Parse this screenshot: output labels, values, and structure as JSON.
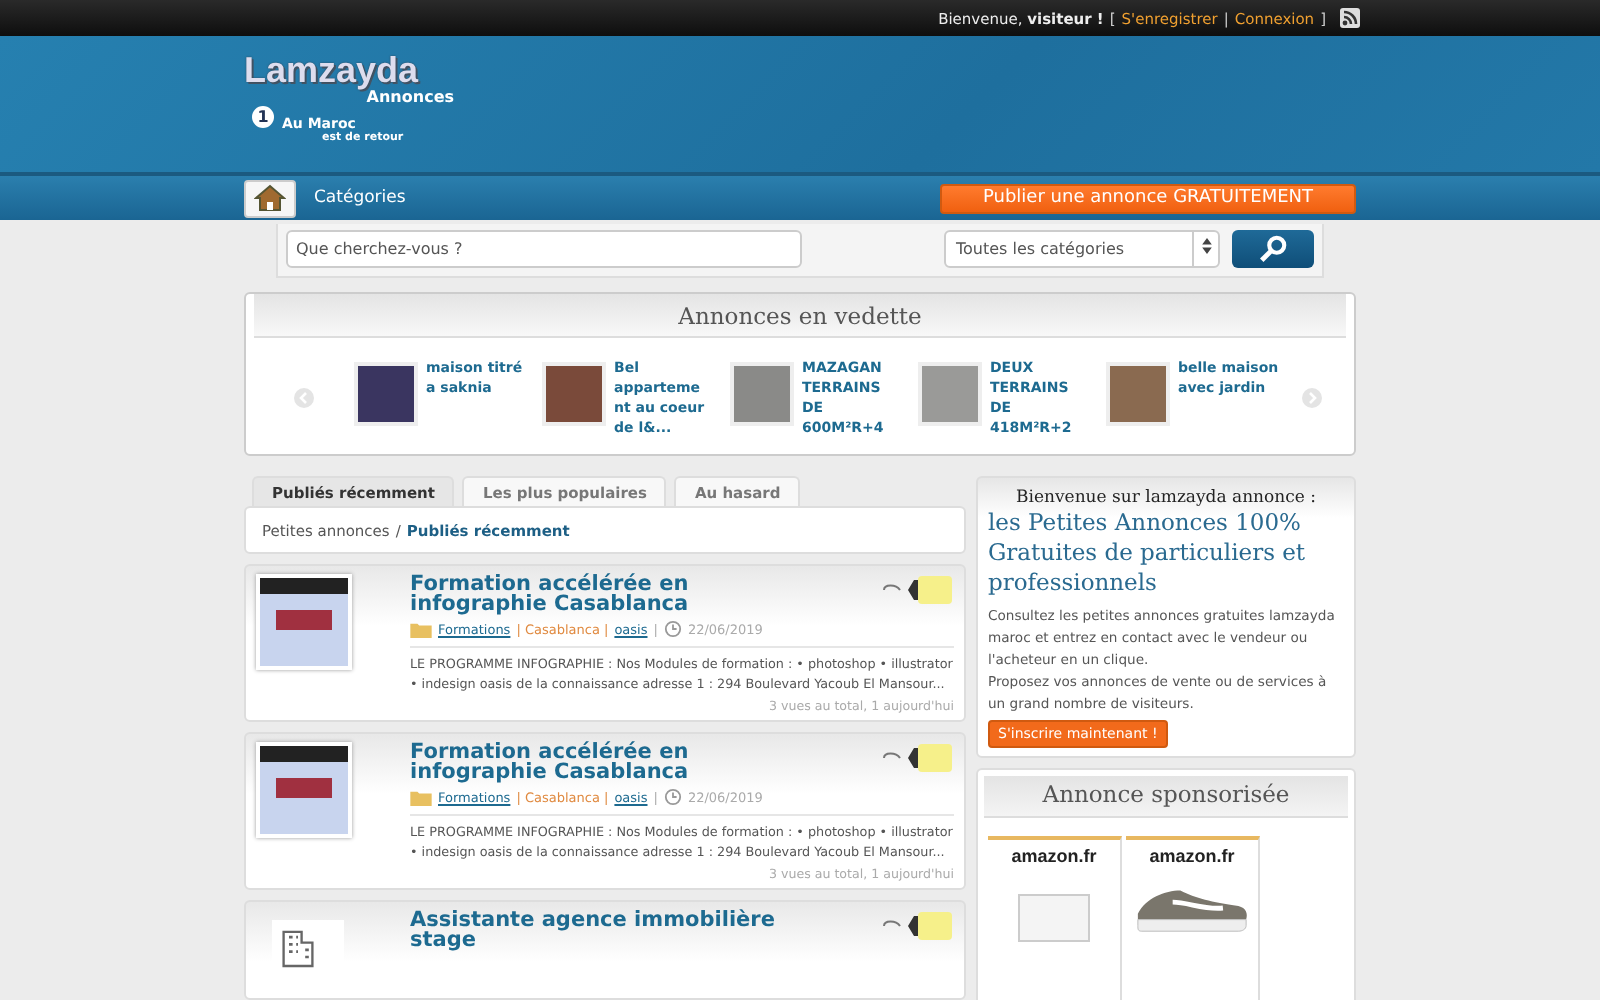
{
  "top_bar": {
    "greeting": "Bienvenue,",
    "user": "visiteur !",
    "open_bracket": "[",
    "register": "S'enregistrer",
    "separator": "|",
    "login": "Connexion",
    "close_bracket": "]"
  },
  "logo": {
    "name": "Lamzayda",
    "sub": "Annonces",
    "tagline_1": "Au Maroc",
    "tagline_2": "est de retour",
    "badge": "1"
  },
  "nav": {
    "categories": "Catégories",
    "publish": "Publier une annonce GRATUITEMENT"
  },
  "search": {
    "placeholder": "Que cherchez-vous ?",
    "category": "Toutes les catégories"
  },
  "featured": {
    "title": "Annonces en vedette",
    "items": [
      {
        "title": "maison titré a saknia"
      },
      {
        "title": "Bel apparteme nt au coeur de l&..."
      },
      {
        "title": "MAZAGAN TERRAINS DE 600M²R+4"
      },
      {
        "title": "DEUX TERRAINS DE 418M²R+2"
      },
      {
        "title": "belle maison avec jardin"
      }
    ]
  },
  "tabs": [
    {
      "label": "Publiés récemment",
      "selected": true
    },
    {
      "label": "Les plus populaires",
      "selected": false
    },
    {
      "label": "Au hasard",
      "selected": false
    }
  ],
  "breadcrumb": {
    "root": "Petites annonces",
    "separator": "/",
    "current": "Publiés récemment"
  },
  "listings": [
    {
      "kind": "photo",
      "title": "Formation accélérée en infographie Casablanca",
      "category": "Formations",
      "city": "| Casablanca |",
      "area": "oasis",
      "separator": "|",
      "date": "22/06/2019",
      "description": "LE PROGRAMME INFOGRAPHIE : Nos Modules de formation : • photoshop • illustrator • indesign oasis de la connaissance adresse 1 : 294 Boulevard Yacoub El Mansour...",
      "stats": "3 vues au total, 1 aujourd'hui"
    },
    {
      "kind": "photo",
      "title": "Formation accélérée en infographie Casablanca",
      "category": "Formations",
      "city": "| Casablanca |",
      "area": "oasis",
      "separator": "|",
      "date": "22/06/2019",
      "description": "LE PROGRAMME INFOGRAPHIE : Nos Modules de formation : • photoshop • illustrator • indesign oasis de la connaissance adresse 1 : 294 Boulevard Yacoub El Mansour...",
      "stats": "3 vues au total, 1 aujourd'hui"
    },
    {
      "kind": "building",
      "title": "Assistante agence immobilière stage"
    }
  ],
  "welcome": {
    "heading": "Bienvenue sur lamzayda annonce :",
    "tagline": "les Petites Annonces 100% Gratuites de particuliers et professionnels",
    "body_1": "Consultez les petites annonces gratuites lamzayda maroc et entrez en contact avec le vendeur ou l'acheteur en un clique.",
    "body_2": "Proposez vos annonces de vente ou de services à un grand nombre de visiteurs.",
    "button": "S'inscrire maintenant !"
  },
  "sponsored": {
    "title": "Annonce sponsorisée",
    "ads": [
      {
        "logo": "amazon.fr",
        "kind": "no-image"
      },
      {
        "logo": "amazon.fr",
        "kind": "shoe"
      }
    ]
  }
}
